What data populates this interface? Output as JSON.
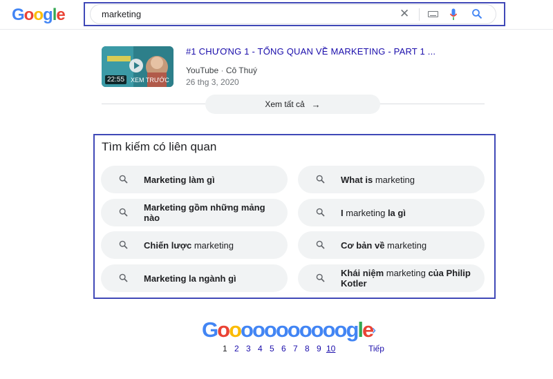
{
  "header": {
    "logo_letters": [
      {
        "ch": "G",
        "color": "#4285f4"
      },
      {
        "ch": "o",
        "color": "#ea4335"
      },
      {
        "ch": "o",
        "color": "#fbbc05"
      },
      {
        "ch": "g",
        "color": "#4285f4"
      },
      {
        "ch": "l",
        "color": "#34a853"
      },
      {
        "ch": "e",
        "color": "#ea4335"
      }
    ],
    "search_query": "marketing",
    "clear_symbol": "✕"
  },
  "video": {
    "title": "#1 CHƯƠNG 1 - TỔNG QUAN VỀ MARKETING - PART 1 ...",
    "source": "YouTube",
    "separator": " · ",
    "author": "Cô Thuý",
    "date": "26 thg 3, 2020",
    "duration": "22:55",
    "preview_label": "XEM TRƯỚC"
  },
  "see_all": {
    "label": "Xem tất cả",
    "arrow": "→"
  },
  "related": {
    "title": "Tìm kiếm có liên quan",
    "items": [
      {
        "parts": [
          {
            "t": "Marketing làm gì",
            "b": true
          }
        ]
      },
      {
        "parts": [
          {
            "t": "What is",
            "b": true
          },
          {
            "t": " marketing",
            "b": false
          }
        ]
      },
      {
        "parts": [
          {
            "t": "Marketing gồm những mảng nào",
            "b": true
          }
        ]
      },
      {
        "parts": [
          {
            "t": "I",
            "b": true
          },
          {
            "t": " marketing ",
            "b": false
          },
          {
            "t": "la gì",
            "b": true
          }
        ]
      },
      {
        "parts": [
          {
            "t": "Chiến lược",
            "b": true
          },
          {
            "t": " marketing",
            "b": false
          }
        ]
      },
      {
        "parts": [
          {
            "t": "Cơ bản về",
            "b": true
          },
          {
            "t": " marketing",
            "b": false
          }
        ]
      },
      {
        "parts": [
          {
            "t": "Marketing la ngành gì",
            "b": true
          }
        ]
      },
      {
        "parts": [
          {
            "t": "Khái niệm",
            "b": true
          },
          {
            "t": " marketing ",
            "b": false
          },
          {
            "t": "của Philip Kotler",
            "b": true
          }
        ]
      }
    ]
  },
  "pagination": {
    "goo_letters": [
      {
        "ch": "G",
        "color": "#4285f4"
      },
      {
        "ch": "o",
        "color": "#ea4335"
      },
      {
        "ch": "o",
        "color": "#fbbc05"
      },
      {
        "ch": "o",
        "color": "#4285f4"
      },
      {
        "ch": "o",
        "color": "#4285f4"
      },
      {
        "ch": "o",
        "color": "#4285f4"
      },
      {
        "ch": "o",
        "color": "#4285f4"
      },
      {
        "ch": "o",
        "color": "#4285f4"
      },
      {
        "ch": "o",
        "color": "#4285f4"
      },
      {
        "ch": "o",
        "color": "#4285f4"
      },
      {
        "ch": "o",
        "color": "#4285f4"
      },
      {
        "ch": "o",
        "color": "#4285f4"
      },
      {
        "ch": "g",
        "color": "#4285f4"
      },
      {
        "ch": "l",
        "color": "#34a853"
      },
      {
        "ch": "e",
        "color": "#ea4335"
      }
    ],
    "pages": [
      "1",
      "2",
      "3",
      "4",
      "5",
      "6",
      "7",
      "8",
      "9",
      "10"
    ],
    "current": "1",
    "next_chevron": "›",
    "next_label": "Tiếp"
  },
  "colors": {
    "highlight_border": "#3f48b7",
    "link": "#1a0dab",
    "chip_bg": "#f1f3f4"
  }
}
